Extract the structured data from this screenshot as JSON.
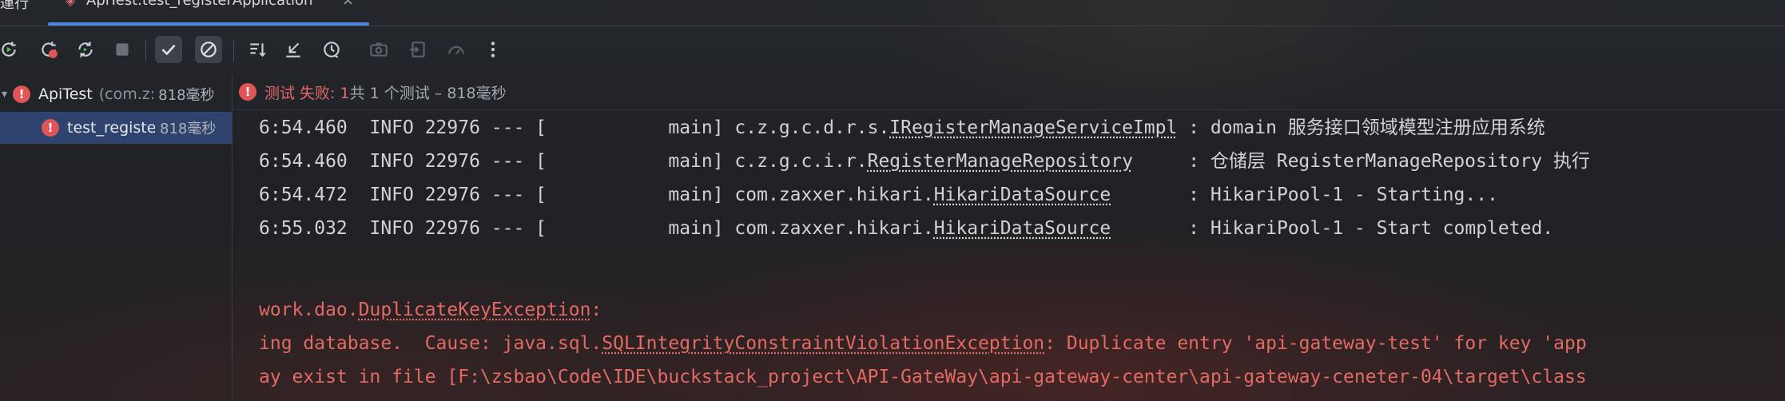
{
  "tab_strip": {
    "left_fragment": "運行",
    "active_tab": {
      "label": "ApiTest.test_registerApplication",
      "close": "×"
    }
  },
  "toolbar": {
    "buttons": [
      {
        "name": "rerun-icon"
      },
      {
        "name": "rerun-failed-icon"
      },
      {
        "name": "toggle-auto-test-icon"
      },
      {
        "name": "stop-icon"
      },
      {
        "name": "show-passed-icon"
      },
      {
        "name": "show-ignored-icon"
      },
      {
        "name": "sort-icon"
      },
      {
        "name": "import-tests-icon"
      },
      {
        "name": "history-icon"
      },
      {
        "name": "screenshot-icon"
      },
      {
        "name": "export-icon"
      },
      {
        "name": "coverage-icon"
      },
      {
        "name": "more-icon"
      }
    ]
  },
  "tree": {
    "items": [
      {
        "name": "ApiTest",
        "package": "(com.z:",
        "time": "818毫秒",
        "status": "failed"
      },
      {
        "name": "test_registe",
        "time": "818毫秒",
        "status": "failed"
      }
    ]
  },
  "status": {
    "failed_text": "测试 失败: 1",
    "rest_text": "共 1 个测试 – 818毫秒"
  },
  "console": {
    "info_lines": [
      {
        "prefix": "6:54.460  INFO 22976 --- [           main] c.z.g.c.d.r.s.",
        "cls": "IRegisterManageServiceImpl",
        "suffix": " : domain 服务接口领域模型注册应用系统"
      },
      {
        "prefix": "6:54.460  INFO 22976 --- [           main] c.z.g.c.i.r.",
        "cls": "RegisterManageRepository",
        "suffix": "     : 仓储层 RegisterManageRepository 执行"
      },
      {
        "prefix": "6:54.472  INFO 22976 --- [           main] com.zaxxer.hikari.",
        "cls": "HikariDataSource",
        "suffix": "       : HikariPool-1 - Starting..."
      },
      {
        "prefix": "6:55.032  INFO 22976 --- [           main] com.zaxxer.hikari.",
        "cls": "HikariDataSource",
        "suffix": "       : HikariPool-1 - Start completed."
      }
    ],
    "error_lines": [
      {
        "prefix": "work.dao.",
        "cls": "DuplicateKeyException",
        "suffix": ":"
      },
      {
        "prefix": "ing database.  Cause: java.sql.",
        "cls": "SQLIntegrityConstraintViolationException",
        "suffix": ": Duplicate entry 'api-gateway-test' for key 'app"
      },
      {
        "prefix": "ay exist in file [F:\\zsbao\\Code\\IDE\\buckstack_project\\API-GateWay\\api-gateway-center\\api-gateway-ceneter-04\\target\\class",
        "cls": "",
        "suffix": ""
      }
    ]
  },
  "colors": {
    "error": "#e36a63",
    "accent": "#4f86e0",
    "selection": "#2e436e"
  }
}
